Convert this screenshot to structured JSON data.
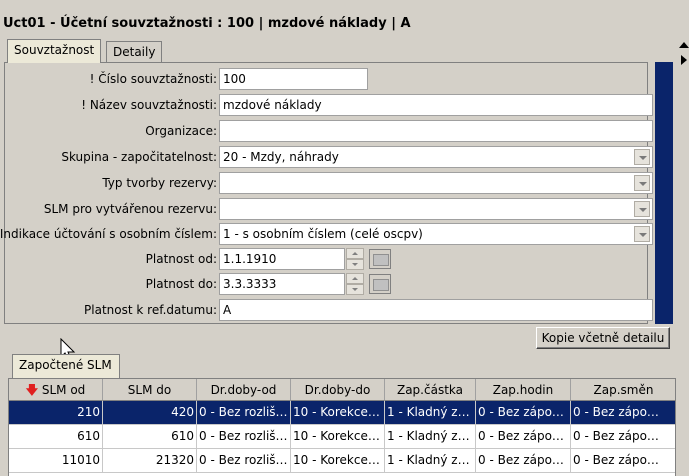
{
  "window": {
    "title": "Uct01 - Účetní souvztažnosti : 100 | mzdové náklady | A"
  },
  "tabs": [
    {
      "label": "Souvztažnost",
      "active": true
    },
    {
      "label": "Detaily",
      "active": false
    }
  ],
  "form": {
    "fields": [
      {
        "label": "! Číslo souvztažnosti:",
        "value": "100",
        "type": "text"
      },
      {
        "label": "! Název souvztažnosti:",
        "value": "mzdové náklady",
        "type": "text"
      },
      {
        "label": "Organizace:",
        "value": "",
        "type": "text"
      },
      {
        "label": "Skupina - započitatelnost:",
        "value": "20 - Mzdy, náhrady",
        "type": "combo"
      },
      {
        "label": "Typ tvorby rezervy:",
        "value": "",
        "type": "combo"
      },
      {
        "label": "SLM pro vytvářenou rezervu:",
        "value": "",
        "type": "combo"
      },
      {
        "label": "Indikace účtování s osobním číslem:",
        "value": "1 - s osobním číslem (celé oscpv)",
        "type": "combo"
      },
      {
        "label": "Platnost od:",
        "value": "1.1.1910",
        "type": "date"
      },
      {
        "label": "Platnost do:",
        "value": "3.3.3333",
        "type": "date"
      },
      {
        "label": "Platnost k ref.datumu:",
        "value": "A",
        "type": "text"
      }
    ]
  },
  "copy_button": {
    "label": "Kopie včetně detailu"
  },
  "lower_tab": {
    "label": "Započtené SLM"
  },
  "grid": {
    "columns": [
      "SLM od",
      "SLM do",
      "Dr.doby-od",
      "Dr.doby-do",
      "Zap.částka",
      "Zap.hodin",
      "Zap.směn"
    ],
    "rows": [
      {
        "c0": "210",
        "c1": "420",
        "c2": "0 - Bez rozliš…",
        "c3": "10 - Korekce…",
        "c4": "1 - Kladný z…",
        "c5": "0 - Bez zápo…",
        "c6": "0 - Bez zápo…",
        "selected": true
      },
      {
        "c0": "610",
        "c1": "610",
        "c2": "0 - Bez rozliš…",
        "c3": "10 - Korekce…",
        "c4": "1 - Kladný z…",
        "c5": "0 - Bez zápo…",
        "c6": "0 - Bez zápo…",
        "selected": false
      },
      {
        "c0": "11010",
        "c1": "21320",
        "c2": "0 - Bez rozliš…",
        "c3": "10 - Korekce…",
        "c4": "1 - Kladný z…",
        "c5": "0 - Bez zápo…",
        "c6": "0 - Bez zápo…",
        "selected": false
      }
    ]
  },
  "colors": {
    "selection": "#0a246a",
    "sort_arrow": "#e02020"
  }
}
